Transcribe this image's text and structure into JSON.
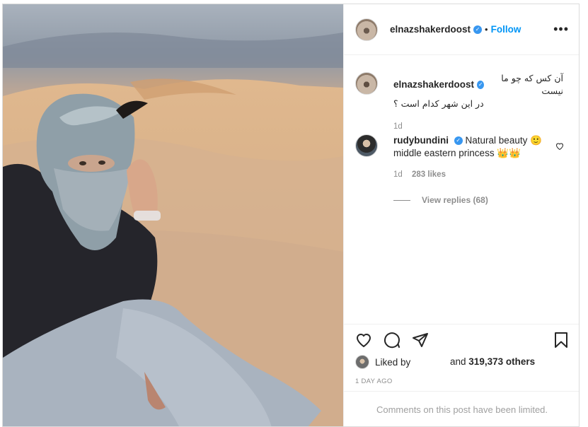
{
  "post": {
    "username": "elnazshakerdoost",
    "follow_label": "Follow",
    "separator": "•",
    "more_label": "•••"
  },
  "caption": {
    "username": "elnazshakerdoost",
    "line1": "آن کس که چو ما نیست",
    "line2": "در این شهر کدام است ؟",
    "time": "1d"
  },
  "comment": {
    "username": "rudybundini",
    "text": "Natural beauty 🙂",
    "text2": "middle eastern princess 👑👑",
    "time": "1d",
    "likes": "283 likes",
    "view_replies": "View replies (68)"
  },
  "likes": {
    "liked_by": "Liked by",
    "and": "and",
    "others": "319,373 others"
  },
  "date": "1 DAY AGO",
  "limited": "Comments on this post have been limited.",
  "icons": {
    "like": "heart-icon",
    "comment": "comment-icon",
    "share": "share-icon",
    "save": "bookmark-icon"
  },
  "colors": {
    "accent": "#0095f6",
    "verified": "#3897f0"
  }
}
